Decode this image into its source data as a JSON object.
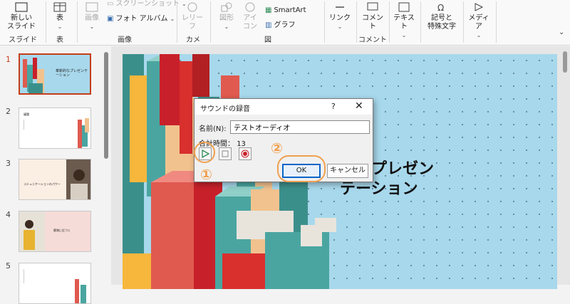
{
  "ribbon": {
    "new_slide": "新しい\nスライド",
    "table": "表",
    "image": "画像",
    "screenshot": "スクリーンショット",
    "photo_album": "フォト アルバム",
    "cameo": "レリー\nフ",
    "shapes": "図形",
    "icons": "アイ\nコン",
    "smartart": "SmartArt",
    "graph": "グラフ",
    "link": "リンク",
    "comment": "コメント",
    "textbox": "テキスト",
    "symbols": "記号と\n特殊文字",
    "media": "メディア",
    "groups": {
      "slide": "スライド",
      "table": "表",
      "image": "画像",
      "camera": "カメラ",
      "illustration": "図",
      "comment": "コメント"
    }
  },
  "thumbnails": [
    {
      "number": "1",
      "title": "革新的なプレゼンテーション"
    },
    {
      "number": "2",
      "title": "議題"
    },
    {
      "number": "3",
      "title": "コミュニケーションのパワー"
    },
    {
      "number": "4",
      "title": "聴衆に近づく"
    },
    {
      "number": "5",
      "title": ""
    }
  ],
  "slide": {
    "title": "革新的なプレゼン\nテーション",
    "visible_title": "的なプレゼン\nテーション"
  },
  "dialog": {
    "title": "サウンドの録音",
    "help": "?",
    "close": "✕",
    "name_label": "名前(N):",
    "name_value": "テストオーディオ",
    "total_label": "合計時間：",
    "total_value": "13",
    "ok": "OK",
    "cancel": "キャンセル"
  },
  "annotations": {
    "one": "①",
    "two": "②"
  },
  "colors": {
    "accent": "#c43e1c",
    "annotation": "#f0a050",
    "slide_bg": "#a8d8ec",
    "ok_border": "#0a64c8"
  }
}
